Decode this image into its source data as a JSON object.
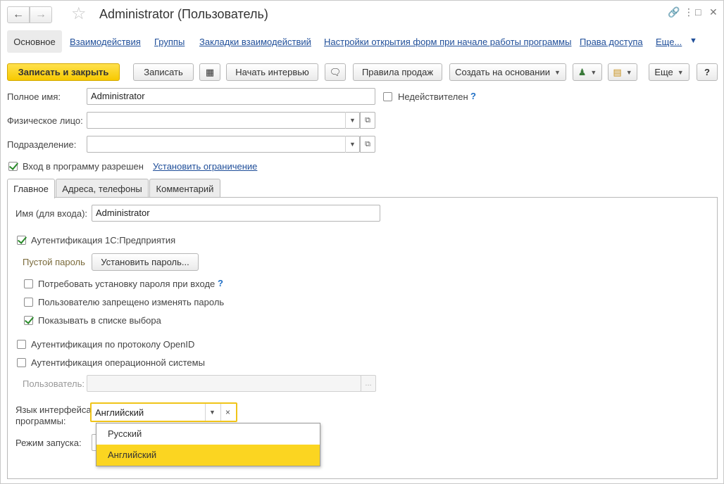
{
  "window": {
    "title": "Administrator (Пользователь)",
    "colors": {
      "accent": "#f7c900",
      "link": "#1f4e99",
      "selected_item": "#fbd521"
    }
  },
  "sections": {
    "active": "Основное",
    "links": [
      "Взаимодействия",
      "Группы",
      "Закладки взаимодействий",
      "Настройки открытия форм при начале работы программы",
      "Права доступа",
      "Еще..."
    ]
  },
  "toolbar": {
    "save_close": "Записать и закрыть",
    "save": "Записать",
    "start_interview": "Начать интервью",
    "sales_rules": "Правила продаж",
    "create_based_on": "Создать на основании",
    "more": "Еще",
    "help": "?"
  },
  "form": {
    "full_name_label": "Полное имя:",
    "full_name_value": "Administrator",
    "invalid_label": "Недействителен",
    "physical_person_label": "Физическое лицо:",
    "physical_person_value": "",
    "department_label": "Подразделение:",
    "department_value": "",
    "login_allowed_label": "Вход в программу разрешен",
    "set_restriction_link": "Установить ограничение"
  },
  "tabs": [
    "Главное",
    "Адреса, телефоны",
    "Комментарий"
  ],
  "main_tab": {
    "login_name_label": "Имя (для входа):",
    "login_name_value": "Administrator",
    "auth_1c_label": "Аутентификация 1С:Предприятия",
    "empty_password_label": "Пустой пароль",
    "set_password_button": "Установить пароль...",
    "require_password_label": "Потребовать установку пароля при входе",
    "forbid_change_label": "Пользователю запрещено изменять пароль",
    "show_in_list_label": "Показывать в списке выбора",
    "openid_label": "Аутентификация по протоколу OpenID",
    "os_auth_label": "Аутентификация операционной системы",
    "os_user_label": "Пользователь:",
    "os_user_value": "",
    "interface_lang_label_1": "Язык интерфейса",
    "interface_lang_label_2": "программы:",
    "interface_lang_value": "Английский",
    "launch_mode_label": "Режим запуска:"
  },
  "dropdown": {
    "options": [
      "Русский",
      "Английский"
    ],
    "selected": "Английский"
  }
}
